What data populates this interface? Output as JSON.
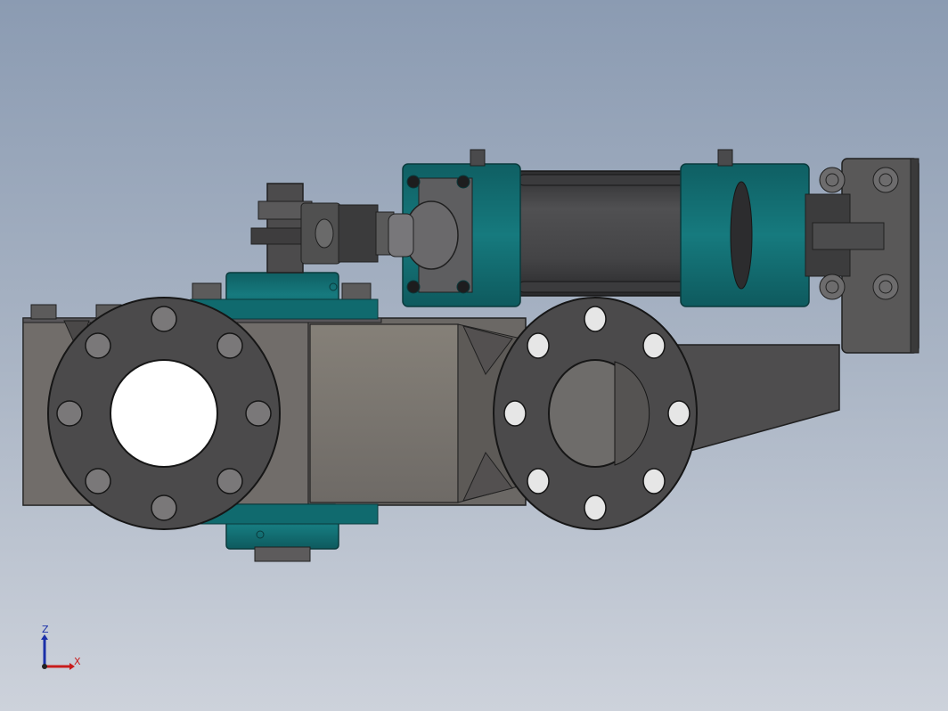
{
  "viewport": {
    "background_top": "#8b9bb2",
    "background_bottom": "#cdd2db"
  },
  "model": {
    "parts": [
      "pneumatic-cylinder",
      "left-flange",
      "right-flange",
      "valve-body",
      "stem-coupling",
      "mounting-bracket",
      "rear-clevis"
    ],
    "colors": {
      "steel": "#4a4a4c",
      "steel_light": "#6e6c6a",
      "teal": "#147478",
      "body": "#7a7672"
    }
  },
  "triad": {
    "z_label": "Z",
    "x_label": "X",
    "z_color": "#1a2fa8",
    "x_color": "#c81c1c"
  }
}
